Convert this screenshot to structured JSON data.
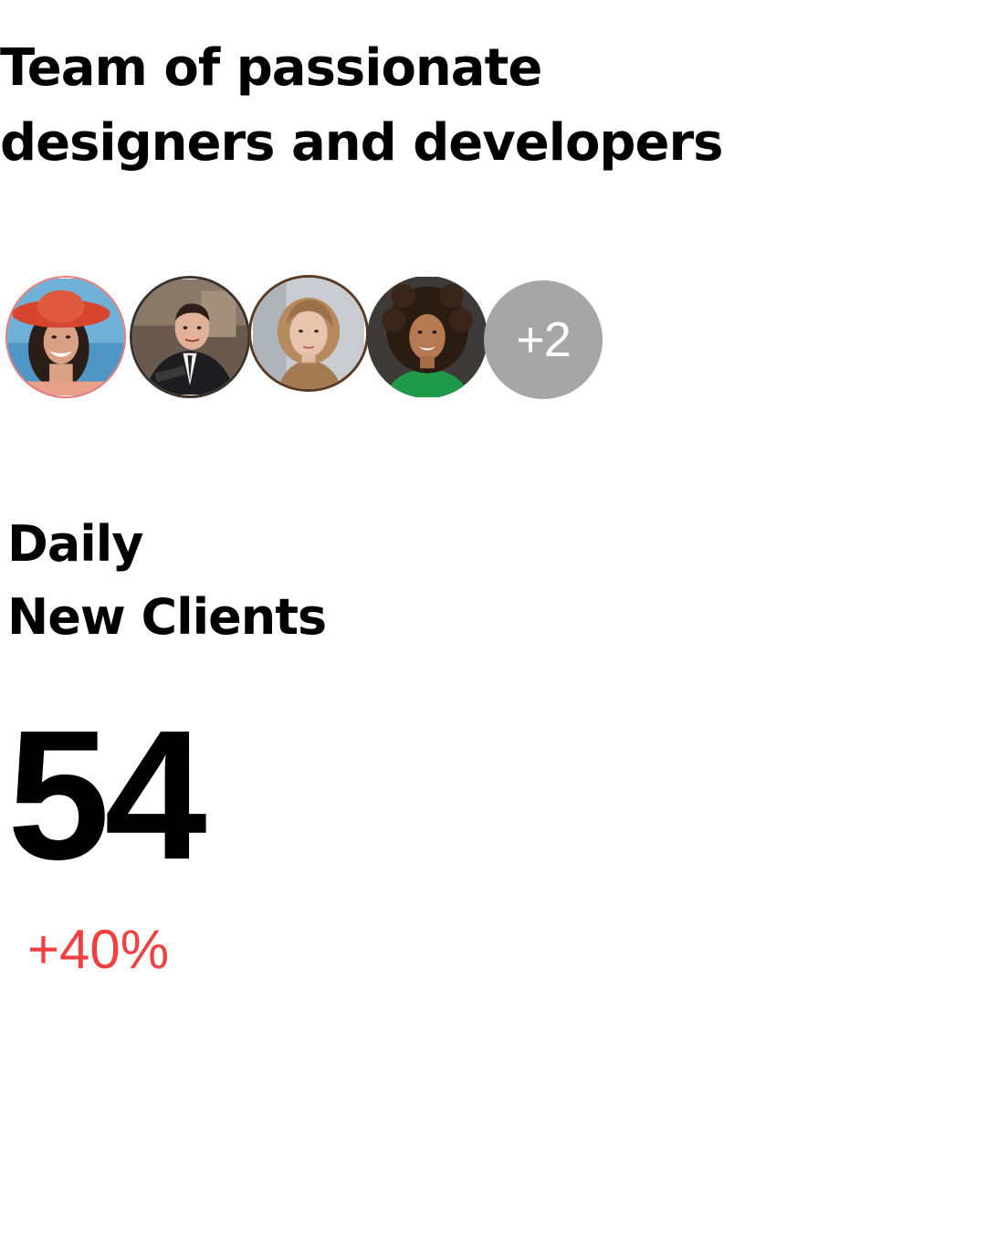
{
  "headline": {
    "line1": "Team of passionate",
    "line2": "designers and developers"
  },
  "team": {
    "avatars": [
      {
        "name": "woman-in-sun-hat-avatar"
      },
      {
        "name": "man-in-suit-avatar"
      },
      {
        "name": "woman-with-bob-haircut-avatar"
      },
      {
        "name": "woman-with-curly-hair-avatar"
      }
    ],
    "more_count": "+2",
    "more_color": "#a6a6a6"
  },
  "metric": {
    "title_line1": "Daily",
    "title_line2": "New Clients",
    "value": "54",
    "change": "+40%",
    "change_color": "#f04040"
  }
}
